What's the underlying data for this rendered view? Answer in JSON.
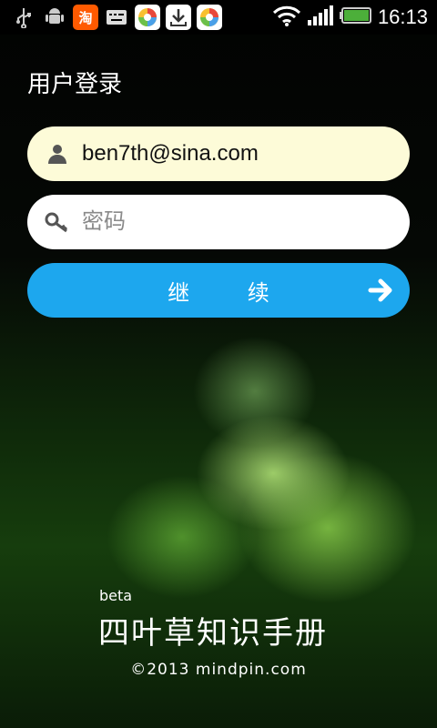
{
  "status_bar": {
    "time": "16:13",
    "notification_icons": [
      "usb-icon",
      "android-debug-icon",
      "taobao-icon",
      "keyboard-icon",
      "app-store-icon",
      "download-icon",
      "app-store-icon"
    ],
    "taobao_label": "淘",
    "battery_color": "#4caf3a"
  },
  "login": {
    "title": "用户登录",
    "email_value": "ben7th@sina.com",
    "password_placeholder": "密码",
    "continue_label": "继 续"
  },
  "footer": {
    "beta": "beta",
    "app_name": "四叶草知识手册",
    "copyright": "©2013 mindpin.com"
  },
  "colors": {
    "accent": "#1da7ee",
    "email_bg": "#fdfbd8"
  }
}
